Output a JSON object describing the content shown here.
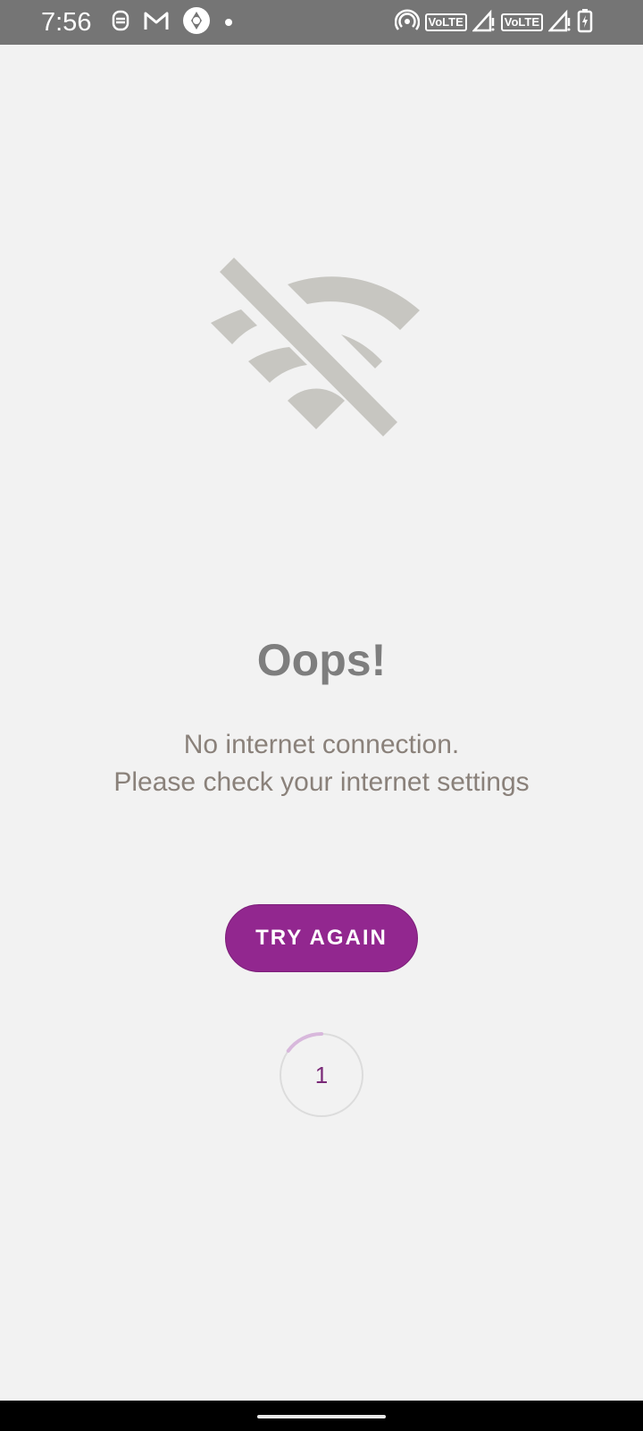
{
  "status_bar": {
    "time": "7:56",
    "left_icons": [
      "assistant-icon",
      "gmail-icon",
      "camera-app-icon",
      "notification-dot-icon"
    ],
    "right_icons": [
      "hotspot-icon",
      "volte-icon",
      "signal-icon",
      "volte-icon",
      "signal-icon",
      "battery-charging-icon"
    ],
    "volte_label": "VoLTE"
  },
  "error_screen": {
    "icon": "wifi-off-icon",
    "title": "Oops!",
    "message_line1": "No internet connection.",
    "message_line2": "Please check your internet settings",
    "retry_button_label": "TRY AGAIN",
    "countdown_value": "1",
    "countdown_progress": 0.15
  },
  "colors": {
    "background": "#f2f2f2",
    "status_bar": "#757575",
    "accent": "#92278f",
    "icon_gray": "#c7c6c1",
    "title_gray": "#7e7e7e",
    "message_gray": "#8a817a"
  }
}
